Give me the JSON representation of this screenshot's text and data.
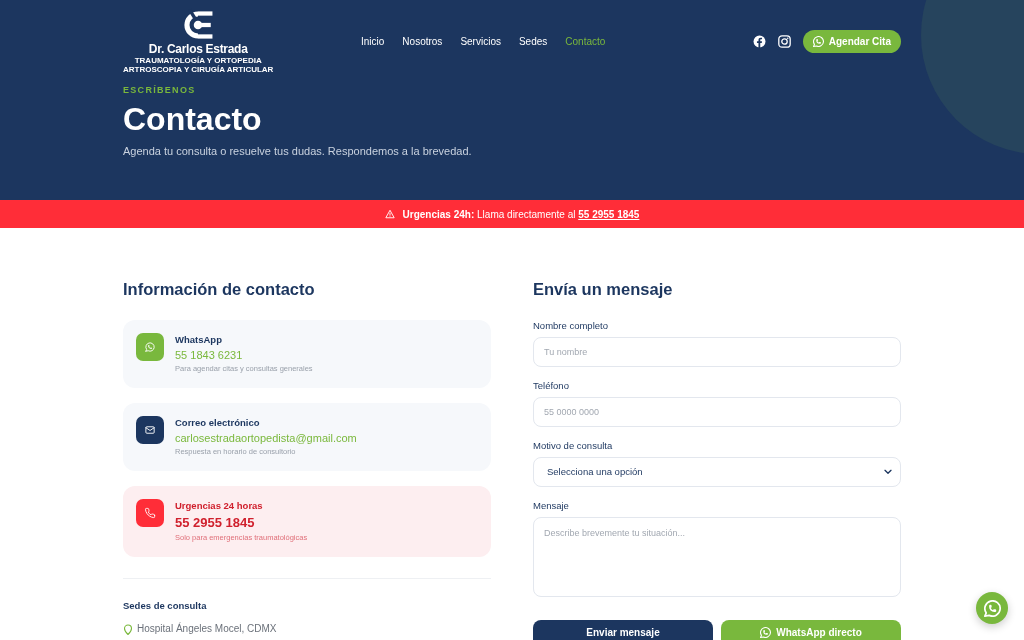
{
  "header": {
    "logo": {
      "name": "Dr. Carlos Estrada",
      "tagline": [
        "TRAUMATOLOGÍA Y ORTOPEDIA",
        "ARTROSCOPIA Y CIRUGÍA ARTICULAR"
      ]
    },
    "nav": [
      {
        "label": "Inicio",
        "selected": false
      },
      {
        "label": "Nosotros",
        "selected": false
      },
      {
        "label": "Servicios",
        "selected": false
      },
      {
        "label": "Sedes",
        "selected": false
      },
      {
        "label": "Contacto",
        "selected": true
      }
    ],
    "cta_button": {
      "label": "Agendar Cita"
    }
  },
  "hero": {
    "eyebrow": "ESCRÍBENOS",
    "title": "Contacto",
    "subtitle": "Agenda tu consulta o resuelve tus dudas. Respondemos a la brevedad."
  },
  "alert_bar": {
    "text": "**Urgencias 24h:** Llama directamente al",
    "phone": "55 2955 1845"
  },
  "contact_info": {
    "title": "Información de contacto",
    "cards": [
      {
        "kind": "whatsapp",
        "title": "WhatsApp",
        "value": "55 1843 6231",
        "note": "Para agendar citas y consultas generales"
      },
      {
        "kind": "email",
        "title": "Correo electrónico",
        "value": "carlosestradaortopedista@gmail.com",
        "note": "Respuesta en horario de consultorio"
      },
      {
        "kind": "emergency",
        "title": "Urgencias 24 horas",
        "value": "55 2955 1845",
        "note": "Solo para emergencias traumatológicas"
      }
    ],
    "locations": {
      "title": "Sedes de consulta",
      "items": [
        "Hospital Ángeles Mocel, CDMX"
      ]
    }
  },
  "form": {
    "title": "Envía un mensaje",
    "fields": [
      {
        "kind": "text",
        "label": "Nombre completo",
        "placeholder": "Tu nombre"
      },
      {
        "kind": "text",
        "label": "Teléfono",
        "placeholder": "55 0000 0000"
      },
      {
        "kind": "select",
        "label": "Motivo de consulta",
        "value": "Selecciona una opción"
      },
      {
        "kind": "textarea",
        "label": "Mensaje",
        "placeholder": "Describe brevemente tu situación..."
      }
    ],
    "buttons": [
      {
        "kind": "primary",
        "label": "Enviar mensaje"
      },
      {
        "kind": "whatsapp",
        "label": "WhatsApp directo"
      }
    ]
  }
}
